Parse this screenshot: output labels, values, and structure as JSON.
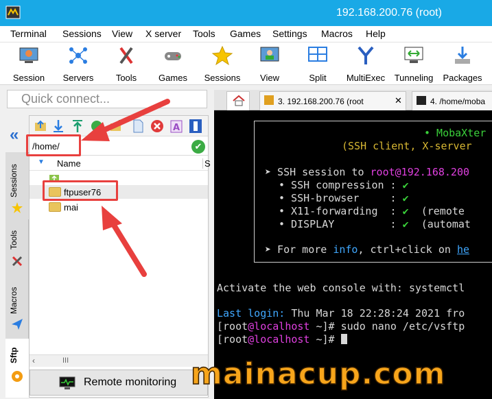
{
  "window": {
    "title": "192.168.200.76 (root)"
  },
  "menu": [
    "Terminal",
    "Sessions",
    "View",
    "X server",
    "Tools",
    "Games",
    "Settings",
    "Macros",
    "Help"
  ],
  "toolbar": [
    {
      "label": "Session",
      "icon": "session-icon"
    },
    {
      "label": "Servers",
      "icon": "servers-icon"
    },
    {
      "label": "Tools",
      "icon": "tools-icon"
    },
    {
      "label": "Games",
      "icon": "games-icon"
    },
    {
      "label": "Sessions",
      "icon": "star-icon"
    },
    {
      "label": "View",
      "icon": "view-icon"
    },
    {
      "label": "Split",
      "icon": "split-icon"
    },
    {
      "label": "MultiExec",
      "icon": "multiexec-icon"
    },
    {
      "label": "Tunneling",
      "icon": "tunneling-icon"
    },
    {
      "label": "Packages",
      "icon": "packages-icon"
    }
  ],
  "quick_connect": {
    "placeholder": "Quick connect..."
  },
  "side_tabs": [
    "Sessions",
    "Tools",
    "Macros",
    "Sftp"
  ],
  "sftp": {
    "path": "/home/",
    "col_name": "Name",
    "col_size": "S",
    "items": [
      "ftpuser76",
      "mai"
    ],
    "scroll_glyph": "III",
    "remote_monitoring": "Remote monitoring"
  },
  "tabs": [
    {
      "label": "3. 192.168.200.76 (root"
    },
    {
      "label": "4. /home/moba"
    }
  ],
  "terminal": {
    "banner_title": "• MobaXter",
    "banner_sub": "(SSH client, X-server",
    "session_prefix": "➤ SSH session to ",
    "session_user": "root",
    "session_host": "@192.168.200",
    "features": [
      {
        "name": "• SSH compression : ",
        "val": "✔",
        "note": ""
      },
      {
        "name": "• SSH-browser     : ",
        "val": "✔",
        "note": ""
      },
      {
        "name": "• X11-forwarding  : ",
        "val": "✔",
        "note": "  (remote"
      },
      {
        "name": "• DISPLAY         : ",
        "val": "✔",
        "note": "  (automat"
      }
    ],
    "more_prefix": "➤ For more ",
    "more_info": "info",
    "more_mid": ", ctrl+click on ",
    "more_link": "he",
    "activate": "Activate the web console with: systemctl",
    "last_login_label": "Last login:",
    "last_login_value": " Thu Mar 18 22:28:24 2021 fro",
    "prompt1_a": "[root",
    "prompt1_host": "@localhost",
    "prompt1_b": " ~]# sudo nano /etc/vsftp",
    "prompt2_b": " ~]# "
  },
  "watermark": "mainacup.com"
}
